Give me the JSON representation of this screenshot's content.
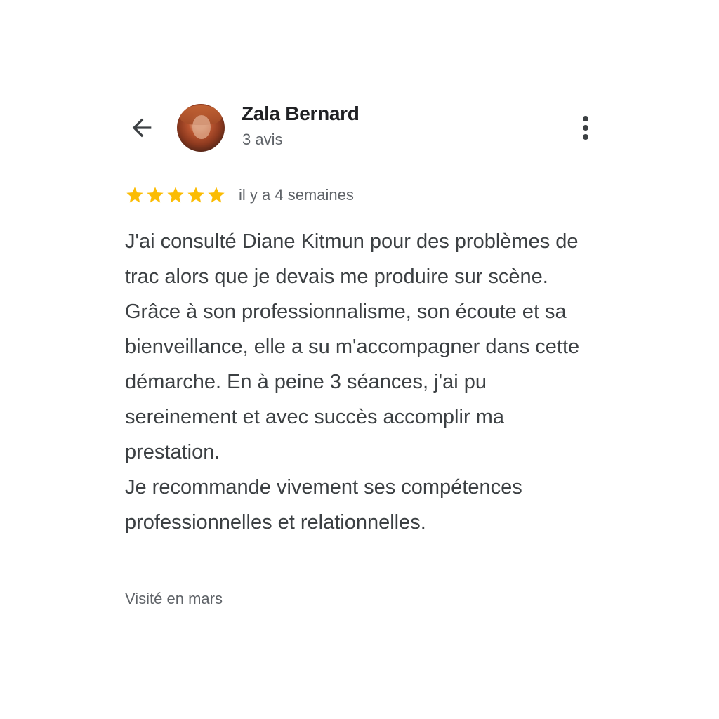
{
  "header": {
    "back_icon": "arrow-left-icon",
    "author_name": "Zala Bernard",
    "review_count": "3 avis",
    "more_icon": "more-vert-icon"
  },
  "review": {
    "rating": 5,
    "rating_max": 5,
    "star_color": "#fbbc04",
    "date": "il y a 4 semaines",
    "text": "J'ai consulté Diane Kitmun pour des problèmes de trac alors que je devais me produire sur scène. Grâce à son professionnalisme, son écoute et sa bienveillance, elle a su m'accompagner dans cette démarche. En à peine 3 séances, j'ai pu sereinement et avec succès accomplir ma prestation.\nJe recommande vivement ses compétences professionnelles et relationnelles.",
    "visit": "Visité en mars"
  }
}
